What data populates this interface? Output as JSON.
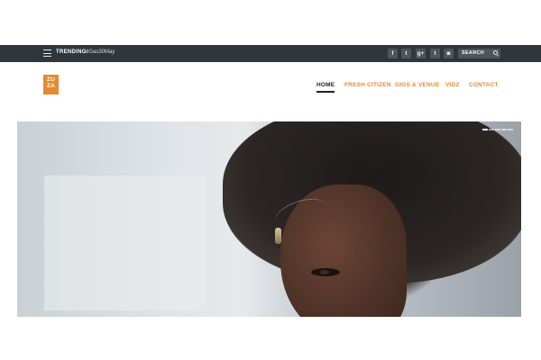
{
  "topbar": {
    "trending_label": "TRENDING:",
    "trending_tag": "#Gas30May",
    "social": [
      {
        "icon": "facebook-icon",
        "glyph": "f"
      },
      {
        "icon": "twitter-icon",
        "glyph": "t"
      },
      {
        "icon": "google-plus-icon",
        "glyph": "g+"
      },
      {
        "icon": "tumblr-icon",
        "glyph": "t"
      },
      {
        "icon": "instagram-icon",
        "glyph": "◙"
      }
    ],
    "search_placeholder": "SEARCH"
  },
  "logo": {
    "line1": "ZU",
    "line2": "ZA"
  },
  "nav": [
    {
      "label": "HOME",
      "active": true
    },
    {
      "label": "FRESH CITIZEN",
      "active": false
    },
    {
      "label": "GIGS & VENUE",
      "active": false
    },
    {
      "label": "VIDZ",
      "active": false
    },
    {
      "label": "CONTACT",
      "active": false
    }
  ],
  "slider": {
    "slide_count": 5,
    "active_index": 0
  },
  "colors": {
    "accent": "#e68a2e",
    "topbar": "#2f373d",
    "nav_active": "#222222"
  }
}
